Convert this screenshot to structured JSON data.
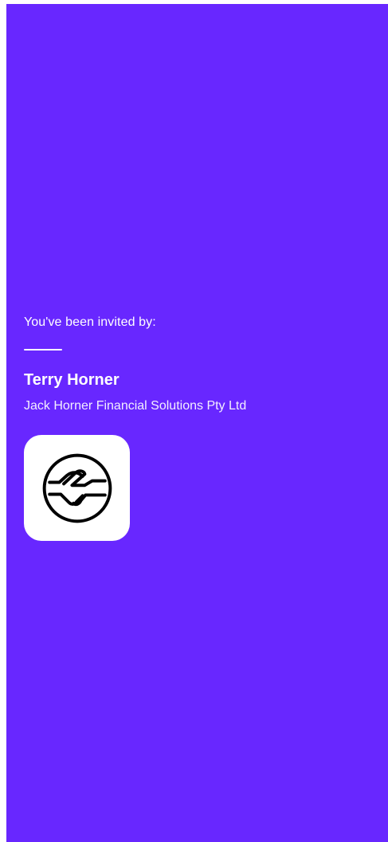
{
  "theme": {
    "background": "#6827ff",
    "text": "#ffffff",
    "logo_background": "#ffffff",
    "logo_stroke": "#000000"
  },
  "invitation": {
    "label": "You've been invited by:",
    "inviter_name": "Terry Horner",
    "company_name": "Jack Horner Financial Solutions Pty Ltd",
    "logo_icon": "handshake-icon"
  }
}
